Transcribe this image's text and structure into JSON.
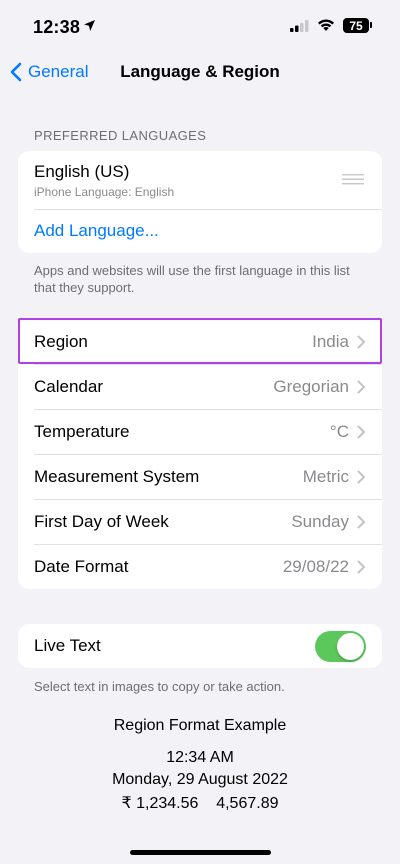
{
  "status_bar": {
    "time": "12:38",
    "battery": "75"
  },
  "nav": {
    "back_label": "General",
    "title": "Language & Region"
  },
  "preferred_languages": {
    "header": "PREFERRED LANGUAGES",
    "language_name": "English (US)",
    "language_sub": "iPhone Language: English",
    "add_label": "Add Language...",
    "footer": "Apps and websites will use the first language in this list that they support."
  },
  "settings": [
    {
      "label": "Region",
      "value": "India"
    },
    {
      "label": "Calendar",
      "value": "Gregorian"
    },
    {
      "label": "Temperature",
      "value": "°C"
    },
    {
      "label": "Measurement System",
      "value": "Metric"
    },
    {
      "label": "First Day of Week",
      "value": "Sunday"
    },
    {
      "label": "Date Format",
      "value": "29/08/22"
    }
  ],
  "live_text": {
    "label": "Live Text",
    "enabled": true,
    "footer": "Select text in images to copy or take action."
  },
  "example": {
    "title": "Region Format Example",
    "time": "12:34 AM",
    "date": "Monday, 29 August 2022",
    "numbers": "₹ 1,234.56    4,567.89"
  },
  "colors": {
    "accent": "#007aff",
    "toggle_on": "#5cc85c",
    "highlight": "#b041e8",
    "background": "#f2f2f7"
  }
}
